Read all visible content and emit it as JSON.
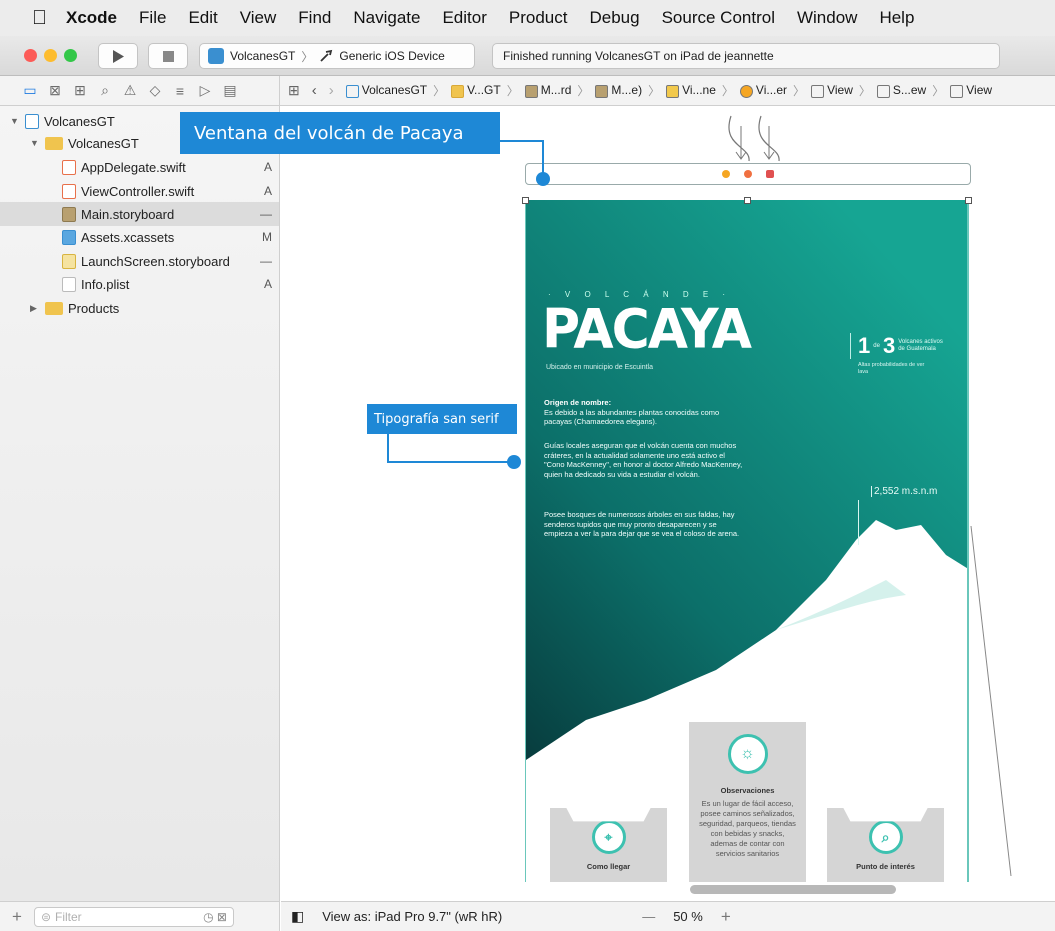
{
  "menubar": {
    "apple": "",
    "items": [
      "Xcode",
      "File",
      "Edit",
      "View",
      "Find",
      "Navigate",
      "Editor",
      "Product",
      "Debug",
      "Source Control",
      "Window",
      "Help"
    ]
  },
  "toolbar": {
    "scheme_name": "VolcanesGT",
    "scheme_separator": "〉",
    "destination": "Generic iOS Device",
    "status": "Finished running VolcanesGT on iPad de jeannette"
  },
  "jumpbar": {
    "items": [
      "VolcanesGT",
      "V...GT",
      "M...rd",
      "M...e)",
      "Vi...ne",
      "Vi...er",
      "View",
      "S...ew",
      "View"
    ]
  },
  "navigator": {
    "files": [
      {
        "name": "VolcanesGT",
        "badge": ""
      },
      {
        "name": "VolcanesGT",
        "badge": ""
      },
      {
        "name": "AppDelegate.swift",
        "badge": "A"
      },
      {
        "name": "ViewController.swift",
        "badge": "A"
      },
      {
        "name": "Main.storyboard",
        "badge": "—"
      },
      {
        "name": "Assets.xcassets",
        "badge": "M"
      },
      {
        "name": "LaunchScreen.storyboard",
        "badge": "—"
      },
      {
        "name": "Info.plist",
        "badge": "A"
      },
      {
        "name": "Products",
        "badge": ""
      }
    ],
    "filter_placeholder": "Filter"
  },
  "annotations": {
    "window_label": "Ventana del volcán de Pacaya",
    "font_label": "Tipografía san serif"
  },
  "scene": {
    "tagline": "· V O L C Á N   D E ·",
    "title": "PACAYA",
    "subtitle": "Ubicado en municipio de Escuintla",
    "origin_title": "Origen de nombre:",
    "origin_text": "Es debido a las abundantes plantas conocidas como pacayas (Chamaedorea elegans).",
    "guides_text": "Guías locales aseguran que el volcán cuenta con muchos cráteres, en la actualidad solamente uno está activo el \"Cono MacKenney\", en honor al doctor Alfredo MacKenney, quien ha dedicado su vida a estudiar el volcán.",
    "forest_text": "Posee bosques de numerosos árboles en sus faldas, hay senderos tupidos que muy pronto desaparecen y se empieza a ver la para dejar que se vea el coloso de arena.",
    "stat_number_1": "1",
    "stat_of": "de",
    "stat_number_2": "3",
    "stat_label": "Volcanes activos de Guatemala",
    "stat_sub": "Altas probabilidades de ver lava",
    "altitude": "2,552 m.s.n.m",
    "card_obs_title": "Observaciones",
    "card_obs_text": "Es un lugar de fácil acceso, posee caminos señalizados, seguridad, parqueos, tiendas con bebidas y snacks, ademas de contar con servicios sanitarios",
    "card_left_title": "Como llegar",
    "card_right_title": "Punto de interés"
  },
  "bottombar": {
    "view_as": "View as: iPad Pro 9.7\" (wR hR)",
    "zoom": "50 %",
    "zoom_out": "—",
    "zoom_in": "+"
  },
  "colors": {
    "accent": "#1e88d6",
    "teal_dark": "#0b3a3e",
    "teal": "#15a18f"
  }
}
